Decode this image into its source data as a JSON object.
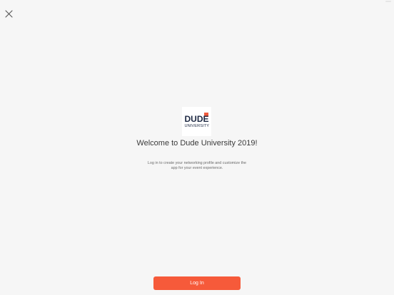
{
  "icons": {
    "close": "close-icon"
  },
  "logo": {
    "word": "DUDE",
    "sub": "UNIVERSITY",
    "accent_color": "#f05a3c",
    "text_color": "#1f2a44"
  },
  "welcome": {
    "title": "Welcome to Dude University 2019!",
    "subtitle": "Log in to create your networking profile and customize the app for your event experience."
  },
  "actions": {
    "login_label": "Log In",
    "login_color": "#f65a3a"
  }
}
